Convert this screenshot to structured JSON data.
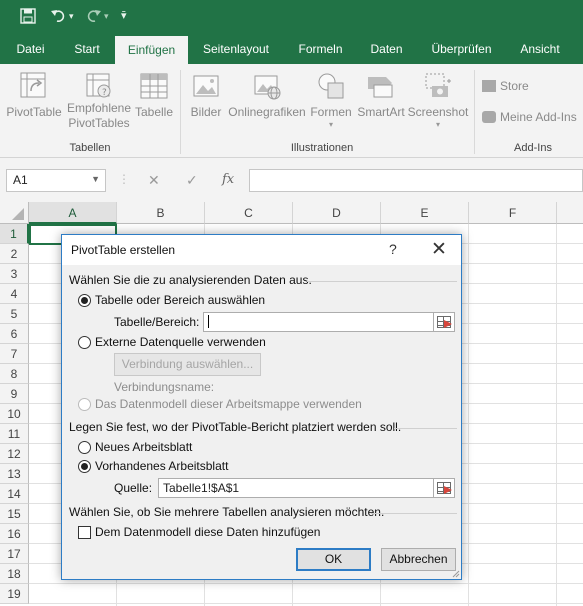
{
  "quick_access": {
    "save_icon": "save-icon",
    "undo_icon": "undo-icon",
    "redo_icon": "redo-icon",
    "customize_icon": "customize-icon"
  },
  "tabs": [
    "Datei",
    "Start",
    "Einfügen",
    "Seitenlayout",
    "Formeln",
    "Daten",
    "Überprüfen",
    "Ansicht"
  ],
  "active_tab": "Einfügen",
  "ribbon": {
    "pivottable": "PivotTable",
    "empfohlene_1": "Empfohlene",
    "empfohlene_2": "PivotTables",
    "tabelle": "Tabelle",
    "group_tabellen": "Tabellen",
    "bilder": "Bilder",
    "onlinegrafiken": "Onlinegrafiken",
    "formen": "Formen",
    "smartart": "SmartArt",
    "screenshot": "Screenshot",
    "group_illustrationen": "Illustrationen",
    "store": "Store",
    "meine_addins": "Meine Add-Ins",
    "group_addins": "Add-Ins"
  },
  "formula_bar": {
    "name_box": "A1",
    "cancel": "✕",
    "enter": "✓",
    "fx": "fx",
    "value": ""
  },
  "columns": [
    "A",
    "B",
    "C",
    "D",
    "E",
    "F"
  ],
  "rows": [
    "1",
    "2",
    "3",
    "4",
    "5",
    "6",
    "7",
    "8",
    "9",
    "10",
    "11",
    "12",
    "13",
    "14",
    "15",
    "16",
    "17",
    "18",
    "19"
  ],
  "dialog": {
    "title": "PivotTable erstellen",
    "help": "?",
    "close": "✕",
    "section1": "Wählen Sie die zu analysierenden Daten aus.",
    "opt_table": "Tabelle oder Bereich auswählen",
    "label_range": "Tabelle/Bereich:",
    "range_value": "",
    "opt_external": "Externe Datenquelle verwenden",
    "btn_connection": "Verbindung auswählen...",
    "label_connname": "Verbindungsname:",
    "opt_datamodel": "Das Datenmodell dieser Arbeitsmappe verwenden",
    "section2": "Legen Sie fest, wo der PivotTable-Bericht platziert werden soll.",
    "opt_new": "Neues Arbeitsblatt",
    "opt_existing": "Vorhandenes Arbeitsblatt",
    "label_source": "Quelle:",
    "source_value": "Tabelle1!$A$1",
    "section3": "Wählen Sie, ob Sie mehrere Tabellen analysieren möchten.",
    "chk_datamodel": "Dem Datenmodell diese Daten hinzufügen",
    "btn_ok": "OK",
    "btn_cancel": "Abbrechen"
  },
  "colors": {
    "accent": "#217346",
    "dialog_border": "#2d7cc5"
  }
}
